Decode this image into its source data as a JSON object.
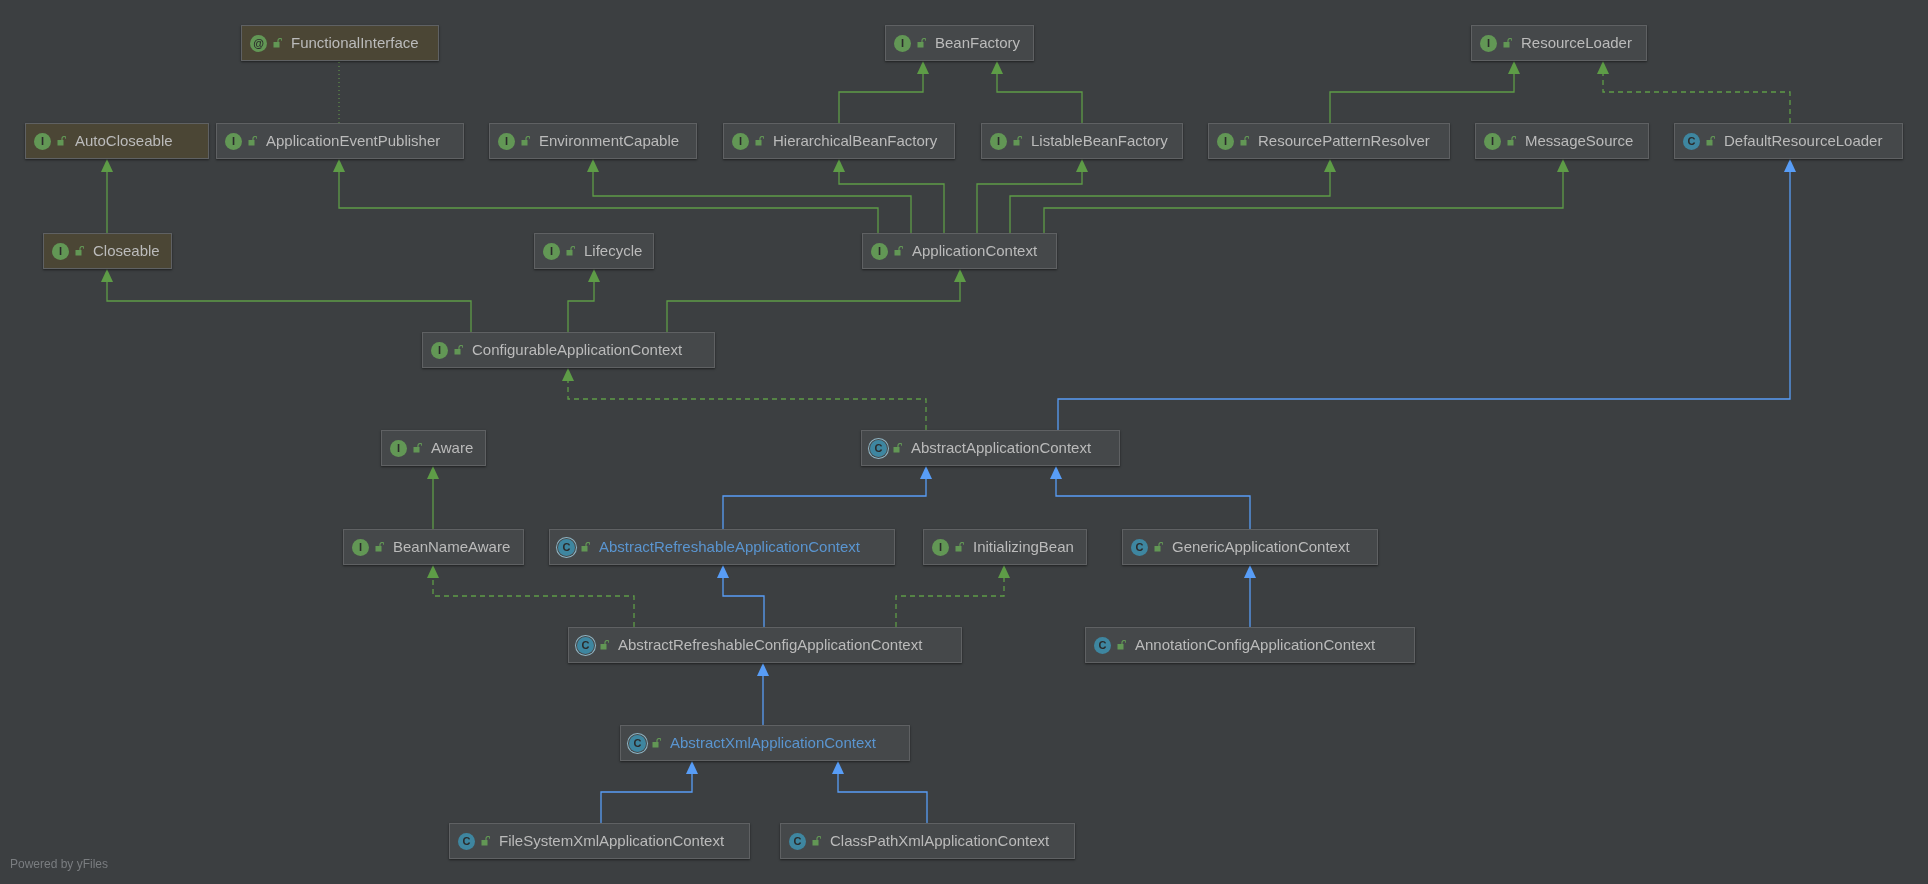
{
  "diagram": {
    "nodes": [
      {
        "name": "FunctionalInterface",
        "badge": "@",
        "kind": "annotation",
        "library": true,
        "color": "#bbbbbb"
      },
      {
        "name": "BeanFactory",
        "badge": "I",
        "kind": "interface",
        "library": false,
        "color": "#bbbbbb"
      },
      {
        "name": "ResourceLoader",
        "badge": "I",
        "kind": "interface",
        "library": false,
        "color": "#bbbbbb"
      },
      {
        "name": "AutoCloseable",
        "badge": "I",
        "kind": "interface",
        "library": true,
        "color": "#bbbbbb"
      },
      {
        "name": "ApplicationEventPublisher",
        "badge": "I",
        "kind": "interface",
        "library": false,
        "color": "#bbbbbb"
      },
      {
        "name": "EnvironmentCapable",
        "badge": "I",
        "kind": "interface",
        "library": false,
        "color": "#bbbbbb"
      },
      {
        "name": "HierarchicalBeanFactory",
        "badge": "I",
        "kind": "interface",
        "library": false,
        "color": "#bbbbbb"
      },
      {
        "name": "ListableBeanFactory",
        "badge": "I",
        "kind": "interface",
        "library": false,
        "color": "#bbbbbb"
      },
      {
        "name": "ResourcePatternResolver",
        "badge": "I",
        "kind": "interface",
        "library": false,
        "color": "#bbbbbb"
      },
      {
        "name": "MessageSource",
        "badge": "I",
        "kind": "interface",
        "library": false,
        "color": "#bbbbbb"
      },
      {
        "name": "DefaultResourceLoader",
        "badge": "C",
        "kind": "class",
        "library": false,
        "color": "#bbbbbb"
      },
      {
        "name": "Closeable",
        "badge": "I",
        "kind": "interface",
        "library": true,
        "color": "#bbbbbb"
      },
      {
        "name": "Lifecycle",
        "badge": "I",
        "kind": "interface",
        "library": false,
        "color": "#bbbbbb"
      },
      {
        "name": "ApplicationContext",
        "badge": "I",
        "kind": "interface",
        "library": false,
        "color": "#bbbbbb"
      },
      {
        "name": "ConfigurableApplicationContext",
        "badge": "I",
        "kind": "interface",
        "library": false,
        "color": "#bbbbbb"
      },
      {
        "name": "Aware",
        "badge": "I",
        "kind": "interface",
        "library": false,
        "color": "#bbbbbb"
      },
      {
        "name": "AbstractApplicationContext",
        "badge": "C",
        "kind": "abstract",
        "library": false,
        "color": "#bbbbbb"
      },
      {
        "name": "BeanNameAware",
        "badge": "I",
        "kind": "interface",
        "library": false,
        "color": "#bbbbbb"
      },
      {
        "name": "AbstractRefreshableApplicationContext",
        "badge": "C",
        "kind": "abstract",
        "library": false,
        "color": "#5a95d0"
      },
      {
        "name": "InitializingBean",
        "badge": "I",
        "kind": "interface",
        "library": false,
        "color": "#bbbbbb"
      },
      {
        "name": "GenericApplicationContext",
        "badge": "C",
        "kind": "class",
        "library": false,
        "color": "#bbbbbb"
      },
      {
        "name": "AbstractRefreshableConfigApplicationContext",
        "badge": "C",
        "kind": "abstract",
        "library": false,
        "color": "#bbbbbb"
      },
      {
        "name": "AnnotationConfigApplicationContext",
        "badge": "C",
        "kind": "class",
        "library": false,
        "color": "#bbbbbb"
      },
      {
        "name": "AbstractXmlApplicationContext",
        "badge": "C",
        "kind": "abstract",
        "library": false,
        "color": "#5a95d0"
      },
      {
        "name": "FileSystemXmlApplicationContext",
        "badge": "C",
        "kind": "class",
        "library": false,
        "color": "#bbbbbb"
      },
      {
        "name": "ClassPathXmlApplicationContext",
        "badge": "C",
        "kind": "class",
        "library": false,
        "color": "#bbbbbb"
      }
    ],
    "edges": [
      {
        "kind": "dotted",
        "color": "#5e8a4a"
      },
      {
        "kind": "solid",
        "color": "#5e9c47"
      },
      {
        "kind": "solid",
        "color": "#5e9c47"
      },
      {
        "kind": "solid",
        "color": "#5e9c47"
      },
      {
        "kind": "dashed",
        "color": "#5e9c47"
      },
      {
        "kind": "solid",
        "color": "#5e9c47"
      },
      {
        "kind": "solid",
        "color": "#5e9c47"
      },
      {
        "kind": "solid",
        "color": "#5e9c47"
      },
      {
        "kind": "solid",
        "color": "#5e9c47"
      },
      {
        "kind": "solid",
        "color": "#5e9c47"
      },
      {
        "kind": "solid",
        "color": "#5e9c47"
      },
      {
        "kind": "solid",
        "color": "#5e9c47"
      },
      {
        "kind": "solid",
        "color": "#5e9c47"
      },
      {
        "kind": "solid",
        "color": "#5e9c47"
      },
      {
        "kind": "solid",
        "color": "#5e9c47"
      },
      {
        "kind": "dashed",
        "color": "#5e9c47"
      },
      {
        "kind": "solid",
        "color": "#589df6"
      },
      {
        "kind": "solid",
        "color": "#5e9c47"
      },
      {
        "kind": "solid",
        "color": "#589df6"
      },
      {
        "kind": "solid",
        "color": "#589df6"
      },
      {
        "kind": "dashed",
        "color": "#5e9c47"
      },
      {
        "kind": "solid",
        "color": "#589df6"
      },
      {
        "kind": "dashed",
        "color": "#5e9c47"
      },
      {
        "kind": "solid",
        "color": "#589df6"
      },
      {
        "kind": "solid",
        "color": "#589df6"
      },
      {
        "kind": "solid",
        "color": "#589df6"
      },
      {
        "kind": "solid",
        "color": "#589df6"
      }
    ]
  },
  "footer": {
    "text": "Powered by yFiles"
  }
}
